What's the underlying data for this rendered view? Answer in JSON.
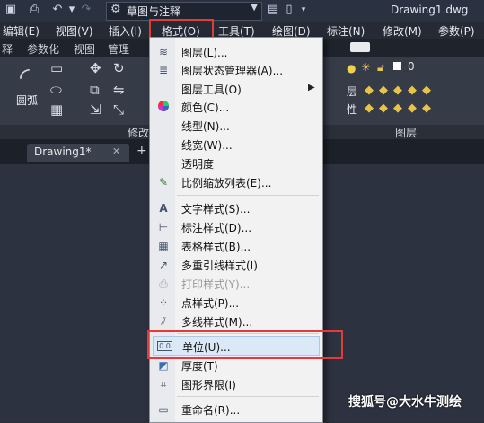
{
  "titlebar": {
    "workspace": "草图与注释",
    "document_title": "Drawing1.dwg"
  },
  "menubar": {
    "items": [
      "编辑(E)",
      "视图(V)",
      "插入(I)",
      "格式(O)",
      "工具(T)",
      "绘图(D)",
      "标注(N)",
      "修改(M)",
      "参数(P)"
    ]
  },
  "ribbon": {
    "tabs": [
      "释",
      "参数化",
      "视图",
      "管理"
    ],
    "arc_label": "圆弧",
    "modify_panel": "修改",
    "layer_panel": "图层",
    "layer_value": "0",
    "side_labels": [
      "层",
      "性"
    ]
  },
  "filetab": {
    "name": "Drawing1*",
    "close": "✕",
    "add": "+"
  },
  "dropdown": {
    "items": [
      {
        "label": "图层(L)...",
        "icon": "layer-icon"
      },
      {
        "label": "图层状态管理器(A)...",
        "icon": "layer-states-icon"
      },
      {
        "label": "图层工具(O)",
        "icon": "",
        "submenu": true
      },
      {
        "label": "颜色(C)...",
        "icon": "color-wheel-icon"
      },
      {
        "label": "线型(N)...",
        "icon": ""
      },
      {
        "label": "线宽(W)...",
        "icon": ""
      },
      {
        "label": "透明度",
        "icon": ""
      },
      {
        "label": "比例缩放列表(E)...",
        "icon": "scale-list-icon"
      },
      {
        "label": "文字样式(S)...",
        "icon": "text-style-icon"
      },
      {
        "label": "标注样式(D)...",
        "icon": "dim-style-icon"
      },
      {
        "label": "表格样式(B)...",
        "icon": "table-style-icon"
      },
      {
        "label": "多重引线样式(I)",
        "icon": "mleader-style-icon"
      },
      {
        "label": "打印样式(Y)...",
        "icon": "plot-style-icon",
        "disabled": true
      },
      {
        "label": "点样式(P)...",
        "icon": "point-style-icon"
      },
      {
        "label": "多线样式(M)...",
        "icon": "mline-style-icon"
      },
      {
        "label": "单位(U)...",
        "icon": "units-icon",
        "highlighted": true
      },
      {
        "label": "厚度(T)",
        "icon": "thickness-icon"
      },
      {
        "label": "图形界限(I)",
        "icon": "limits-icon"
      },
      {
        "label": "重命名(R)...",
        "icon": "rename-icon"
      }
    ]
  },
  "watermark": "搜狐号@大水牛测绘"
}
